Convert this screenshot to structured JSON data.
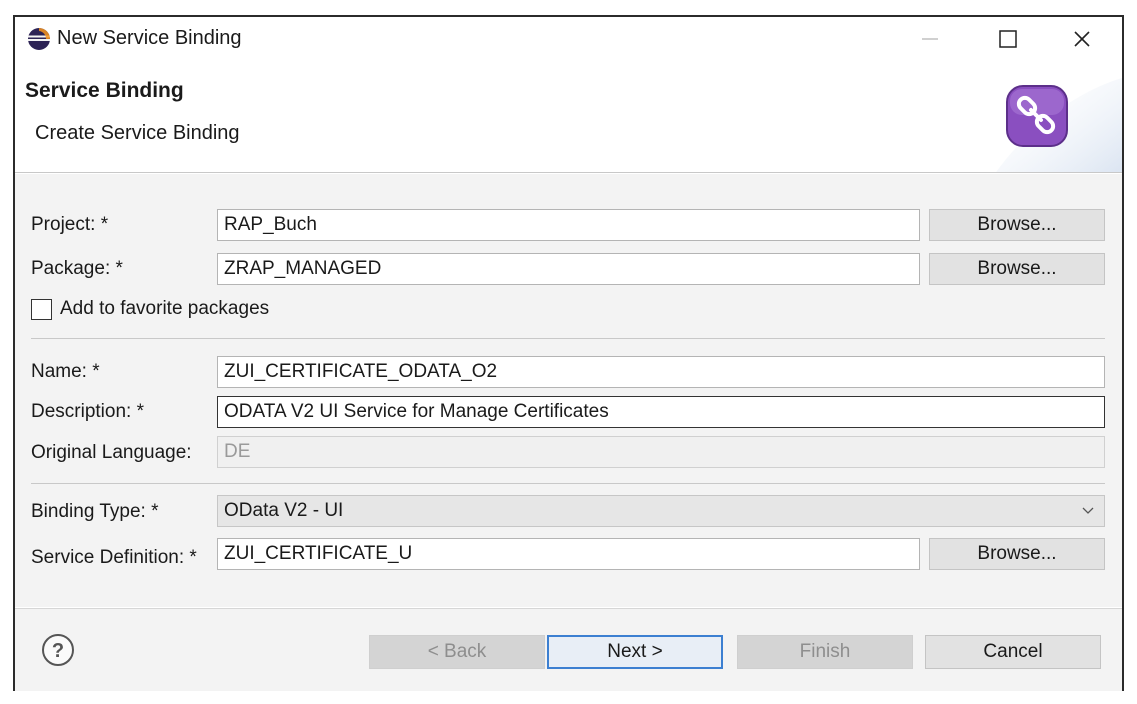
{
  "window": {
    "title": "New Service Binding"
  },
  "banner": {
    "title": "Service Binding",
    "subtitle": "Create Service Binding"
  },
  "form": {
    "project": {
      "label": "Project: *",
      "value": "RAP_Buch",
      "browse": "Browse..."
    },
    "package": {
      "label": "Package: *",
      "value": "ZRAP_MANAGED",
      "browse": "Browse..."
    },
    "favorite": {
      "label": "Add to favorite packages",
      "checked": false
    },
    "name": {
      "label": "Name: *",
      "value": "ZUI_CERTIFICATE_ODATA_O2"
    },
    "description": {
      "label": "Description: *",
      "value": "ODATA V2 UI Service for Manage Certificates"
    },
    "language": {
      "label": "Original Language:",
      "value": "DE"
    },
    "binding_type": {
      "label": "Binding Type: *",
      "value": "OData V2 - UI"
    },
    "service_definition": {
      "label": "Service Definition: *",
      "value": "ZUI_CERTIFICATE_U",
      "browse": "Browse..."
    }
  },
  "footer": {
    "back": "< Back",
    "next": "Next >",
    "finish": "Finish",
    "cancel": "Cancel"
  },
  "icons": {
    "app": "eclipse-icon",
    "banner": "service-binding-icon",
    "help": "help-icon"
  },
  "colors": {
    "banner_icon": "#8a4fc0",
    "default_button_border": "#3c7fd1"
  }
}
